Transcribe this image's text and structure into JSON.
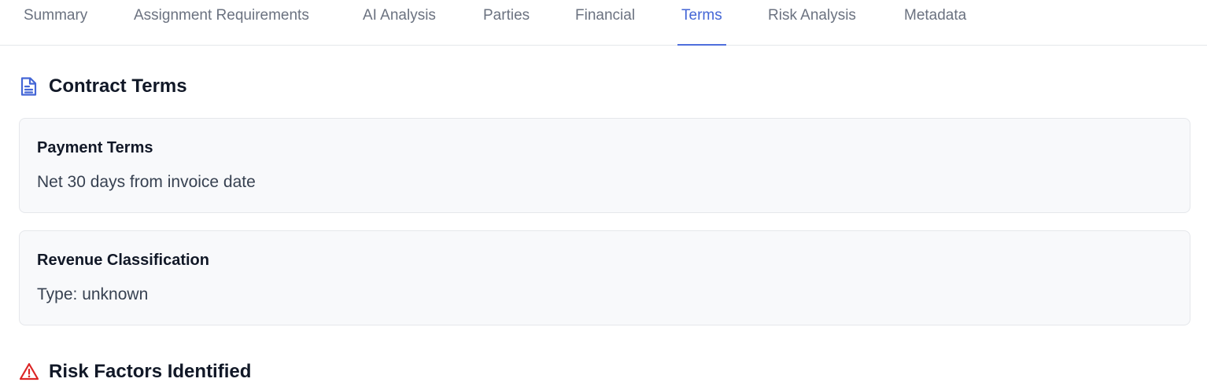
{
  "tabs": [
    {
      "label": "Summary",
      "active": false
    },
    {
      "label": "Assignment Requirements",
      "active": false
    },
    {
      "label": "AI Analysis",
      "active": false
    },
    {
      "label": "Parties",
      "active": false
    },
    {
      "label": "Financial",
      "active": false
    },
    {
      "label": "Terms",
      "active": true
    },
    {
      "label": "Risk Analysis",
      "active": false
    },
    {
      "label": "Metadata",
      "active": false
    }
  ],
  "contract_terms": {
    "title": "Contract Terms",
    "icon": "document-icon",
    "cards": [
      {
        "title": "Payment Terms",
        "text": "Net 30 days from invoice date"
      },
      {
        "title": "Revenue Classification",
        "text": "Type: unknown"
      }
    ]
  },
  "risk_factors": {
    "title": "Risk Factors Identified",
    "icon": "warning-icon"
  },
  "colors": {
    "accent": "#4466d6",
    "risk": "#dc2626",
    "tab_inactive": "#6b7280",
    "card_bg": "#f8f9fb"
  }
}
